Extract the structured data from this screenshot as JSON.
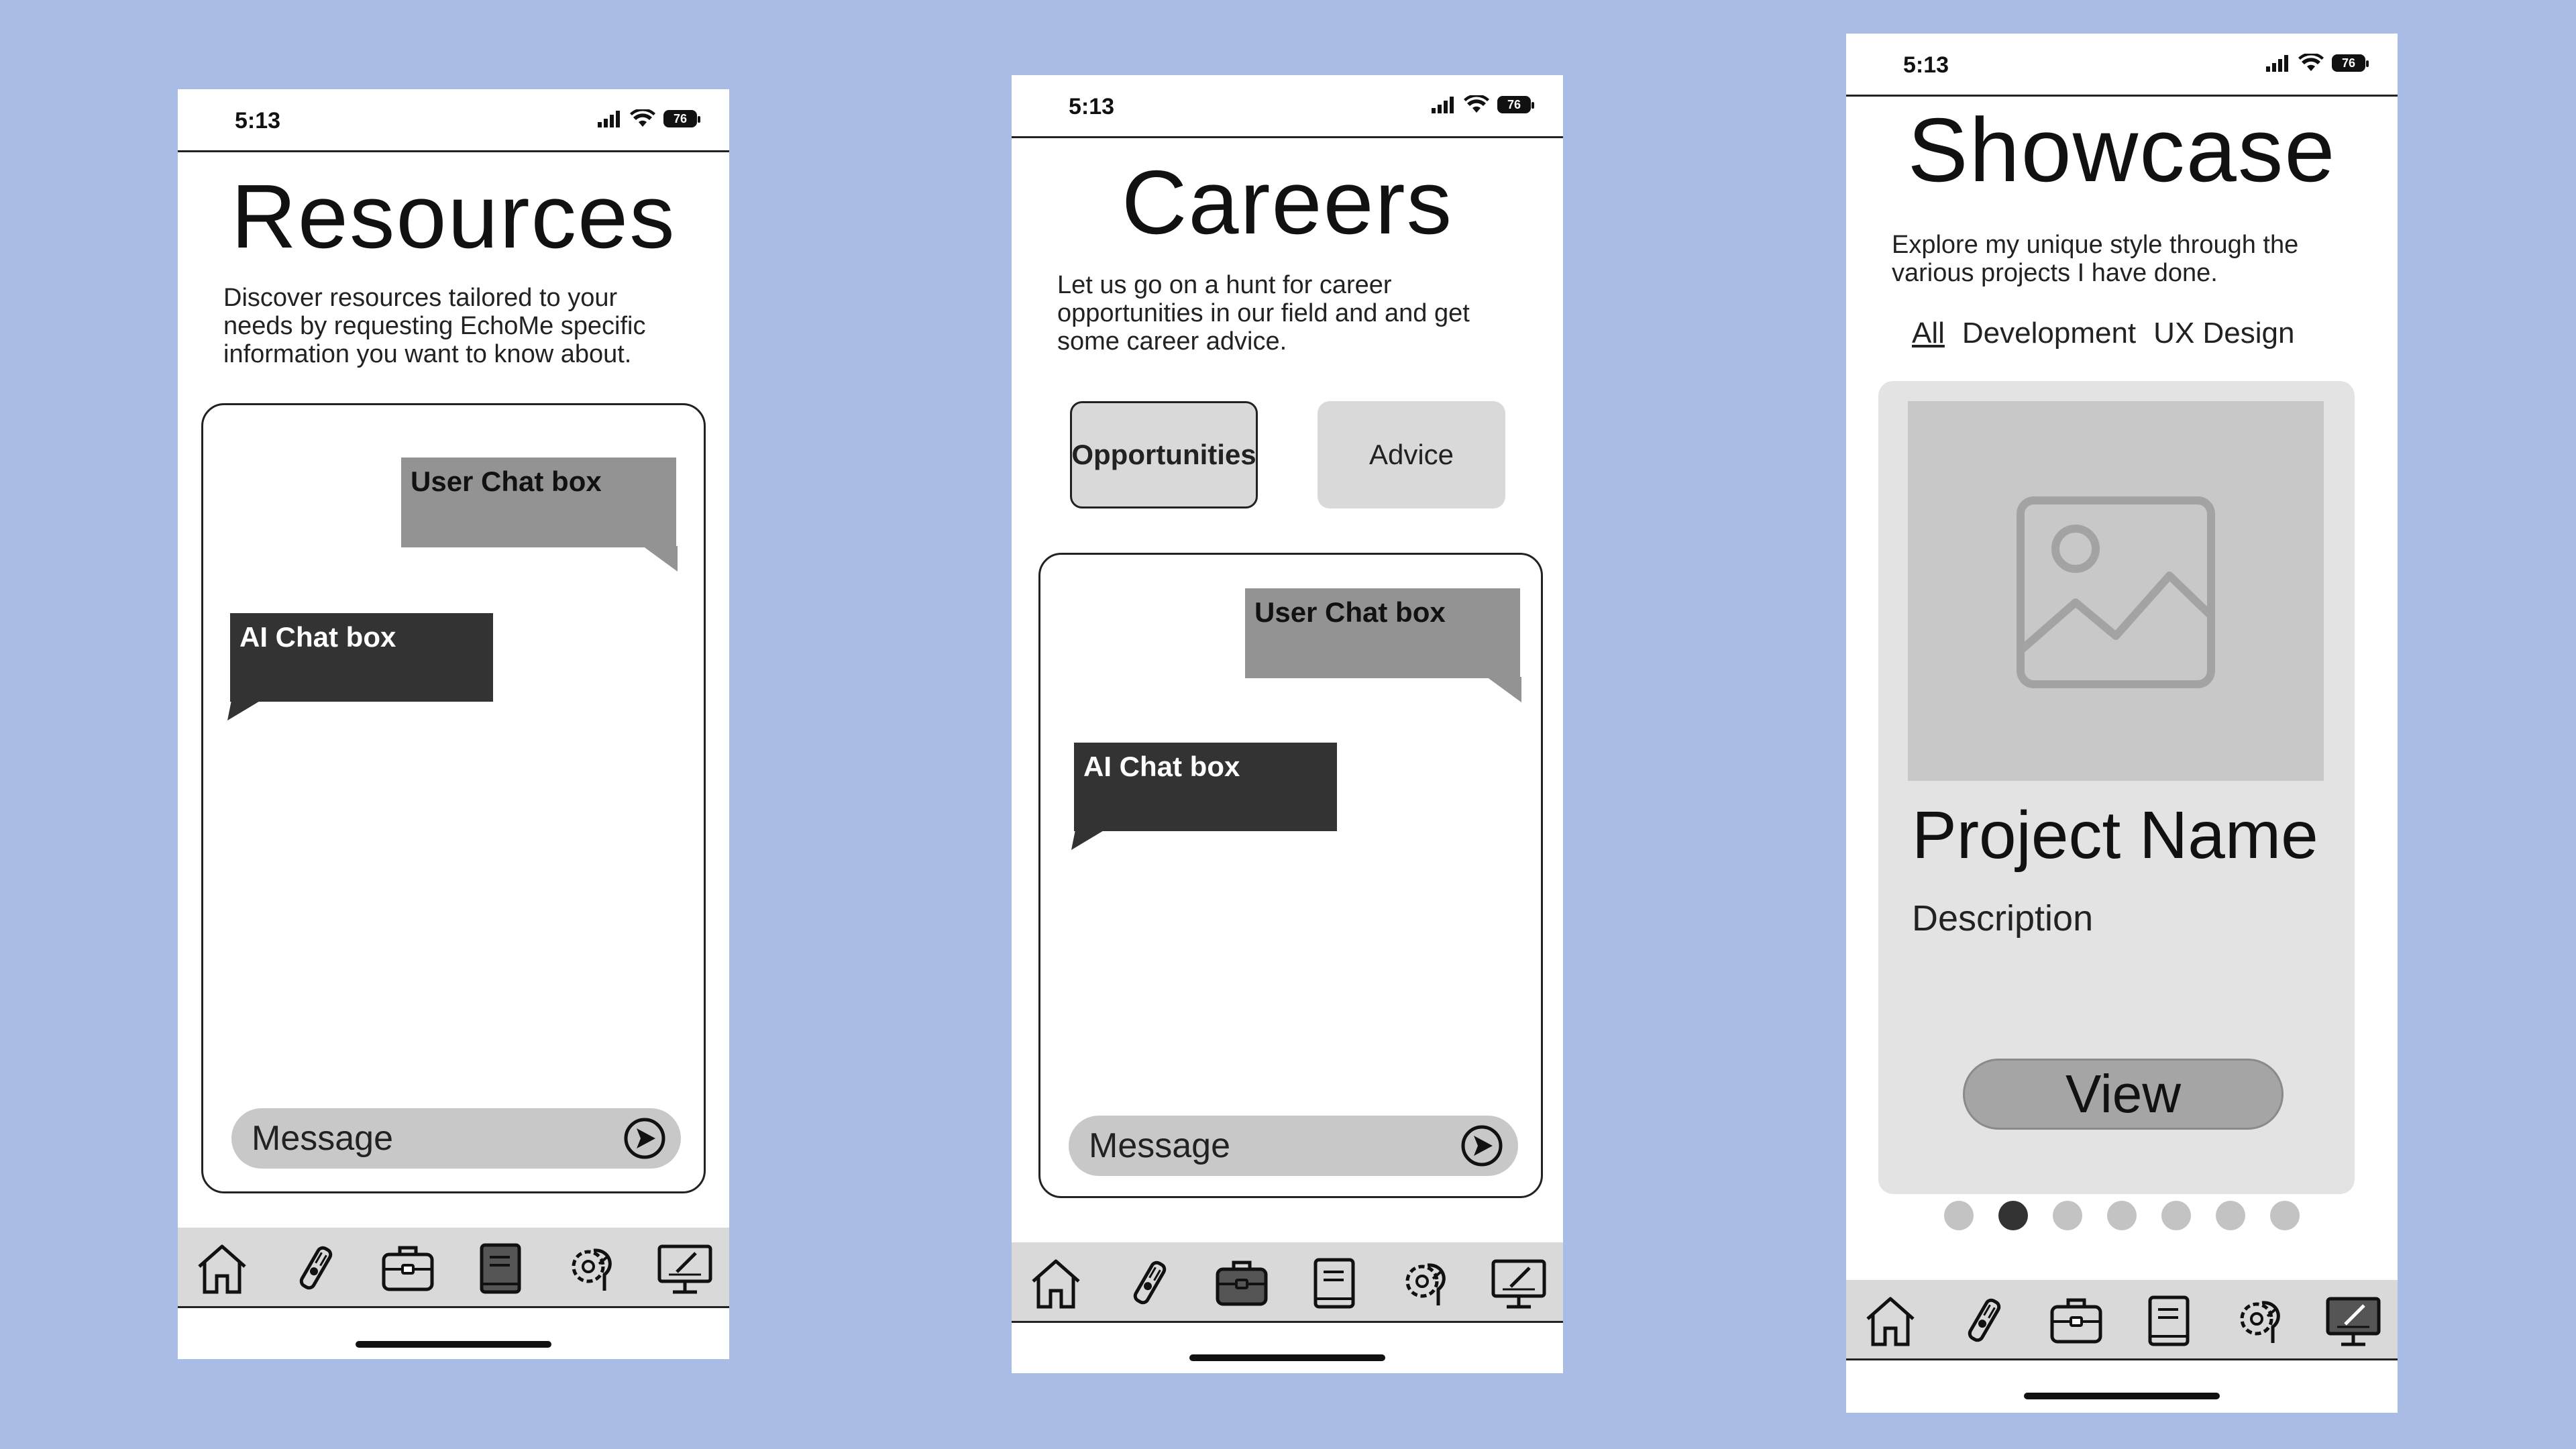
{
  "status": {
    "time": "5:13",
    "battery": "76"
  },
  "resources": {
    "title": "Resources",
    "description_lines": [
      "Discover resources tailored to your",
      "needs by requesting EchoMe specific",
      "information you want to know about."
    ],
    "user_bubble": "User Chat box",
    "ai_bubble": "AI Chat box",
    "message_placeholder": "Message"
  },
  "careers": {
    "title": "Careers",
    "description_lines": [
      "Let us go on a hunt for career",
      "opportunities in our field and and get",
      "some career advice."
    ],
    "buttons": {
      "opportunities": "Opportunities",
      "advice": "Advice"
    },
    "user_bubble": "User Chat box",
    "ai_bubble": "AI Chat box",
    "message_placeholder": "Message"
  },
  "showcase": {
    "title": "Showcase",
    "description_lines": [
      "Explore my unique style through the",
      "various projects I have done."
    ],
    "filters": [
      "All",
      "Development",
      "UX Design"
    ],
    "project_name": "Project Name",
    "project_description": "Description",
    "view_label": "View",
    "carousel": {
      "total": 7,
      "active_index": 1
    }
  },
  "tab_bar_icons": [
    "home-icon",
    "diploma-icon",
    "briefcase-icon",
    "book-icon",
    "brain-gear-icon",
    "monitor-design-icon"
  ],
  "active_tabs": {
    "resources": "book-icon",
    "careers": "briefcase-icon",
    "showcase": "monitor-design-icon"
  },
  "colors": {
    "background": "#a9bce6",
    "user_bubble": "#939393",
    "ai_bubble": "#333333",
    "tab_bar": "#d9d9d9"
  }
}
